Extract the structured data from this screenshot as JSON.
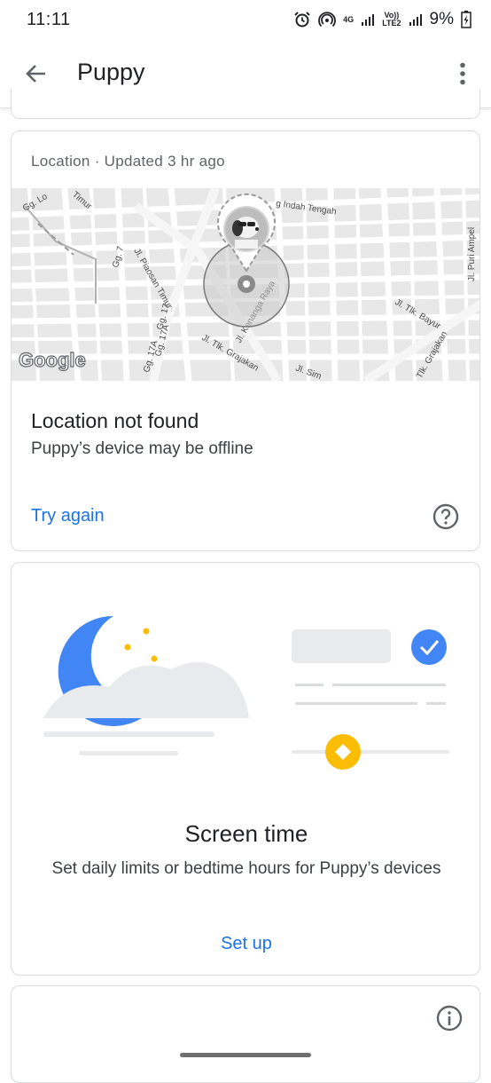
{
  "status_bar": {
    "time": "11:11",
    "network_4g": "4G",
    "volte": "Vo))",
    "lte2": "LTE2",
    "battery": "9%"
  },
  "app_bar": {
    "title": "Puppy"
  },
  "location_card": {
    "header": "Location · Updated 3 hr ago",
    "map_labels": {
      "google": "Google",
      "indah_tengah": "g Indah Tengah",
      "piaosan_timur": "Jl. Piaosan Timur",
      "kenanga_raya": "Jl. Kenanga Raya",
      "tlk_grajakan": "Jl. Tlk. Grajakan",
      "tlk_bayur": "Jl. Tlk. Bayur",
      "puri_ampel": "Jl. Puri Ampel",
      "gg7": "Gg. 7",
      "gg17": "Gg. 17",
      "gg17a": "Gg. 17A",
      "gg17a2": "Gg. 17A",
      "jl_sim": "Jl. Sim",
      "tlk_grajakan2": "Tlk. Grajakan",
      "timur": "Timur",
      "gg_lo": "Gg. Lo"
    },
    "title": "Location not found",
    "subtitle": "Puppy’s device may be offline",
    "action": "Try again"
  },
  "screen_time_card": {
    "title": "Screen time",
    "description": "Set daily limits or bedtime hours for Puppy’s devices",
    "action": "Set up"
  },
  "colors": {
    "accent": "#1a73e8",
    "moon": "#4285f4",
    "star": "#fbbc04",
    "check": "#4285f4"
  }
}
